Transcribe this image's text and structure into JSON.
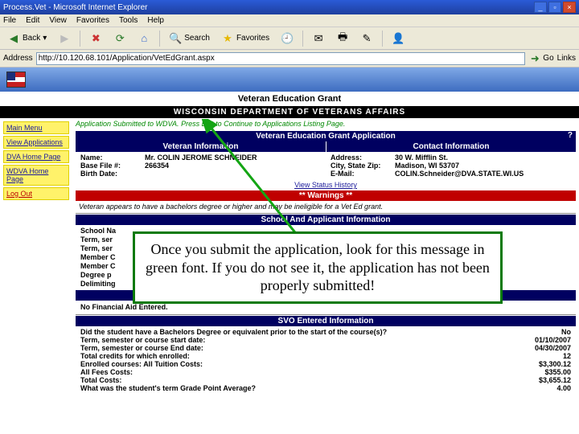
{
  "browser": {
    "title": "Process.Vet - Microsoft Internet Explorer",
    "menus": [
      "File",
      "Edit",
      "View",
      "Favorites",
      "Tools",
      "Help"
    ],
    "buttons": {
      "back": "Back",
      "search": "Search",
      "favorites": "Favorites"
    },
    "address_label": "Address",
    "address_value": "http://10.120.68.101/Application/VetEdGrant.aspx",
    "go": "Go",
    "links": "Links"
  },
  "header": {
    "page_title": "Veteran Education Grant",
    "dept": "WISCONSIN DEPARTMENT OF VETERANS AFFAIRS"
  },
  "sidebar": {
    "items": [
      {
        "label": "Main Menu"
      },
      {
        "label": "View Applications"
      },
      {
        "label": "DVA Home Page"
      },
      {
        "label": "WDVA Home Page"
      },
      {
        "label": "Log Out"
      }
    ]
  },
  "flash": "Application Submitted to WDVA. Press Exit to Continue to Applications Listing Page.",
  "bars": {
    "app_header": "Veteran Education Grant Application",
    "vet_info": "Veteran Information",
    "contact_info": "Contact Information",
    "warnings": "** Warnings **",
    "school": "School And Applicant Information",
    "fin": "Financial",
    "svo": "SVO Entered Information",
    "help": "?"
  },
  "veteran": {
    "name_lbl": "Name:",
    "name_val": "Mr. COLIN JEROME SCHNEIDER",
    "file_lbl": "Base File #:",
    "file_val": "266354",
    "birth_lbl": "Birth Date:",
    "birth_val": ""
  },
  "contact": {
    "addr_lbl": "Address:",
    "addr_val": "30 W. Mifflin St.",
    "city_lbl": "City, State Zip:",
    "city_val": "Madison, WI 53707",
    "email_lbl": "E-Mail:",
    "email_val": "COLIN.Schneider@DVA.STATE.WI.US"
  },
  "status_link": "View Status History",
  "warning_text": "Veteran appears to have a bachelors degree or higher and may be ineligible for a Vet Ed grant.",
  "school_fields": {
    "rows": [
      "School Na",
      "Term, ser",
      "Term, ser",
      "Member C",
      "Member C",
      "Degree p",
      "Delimiting"
    ]
  },
  "no_fin": "No Financial Aid Entered.",
  "svo": {
    "rows": [
      {
        "lbl": "Did the student have a Bachelors Degree or equivalent prior to the start of the course(s)?",
        "val": "No"
      },
      {
        "lbl": "Term, semester or course start date:",
        "val": "01/10/2007"
      },
      {
        "lbl": "Term, semester or course End date:",
        "val": "04/30/2007"
      },
      {
        "lbl": "Total credits for which enrolled:",
        "val": "12"
      },
      {
        "lbl": "Enrolled courses: All Tuition Costs:",
        "val": "$3,300.12"
      },
      {
        "lbl": "All Fees Costs:",
        "val": "$355.00"
      },
      {
        "lbl": "Total Costs:",
        "val": "$3,655.12"
      },
      {
        "lbl": "What was the student's term Grade Point Average?",
        "val": "4.00"
      }
    ]
  },
  "callout": "Once you submit the application, look for this message in green font.  If you do not see it, the application has not been properly submitted!"
}
